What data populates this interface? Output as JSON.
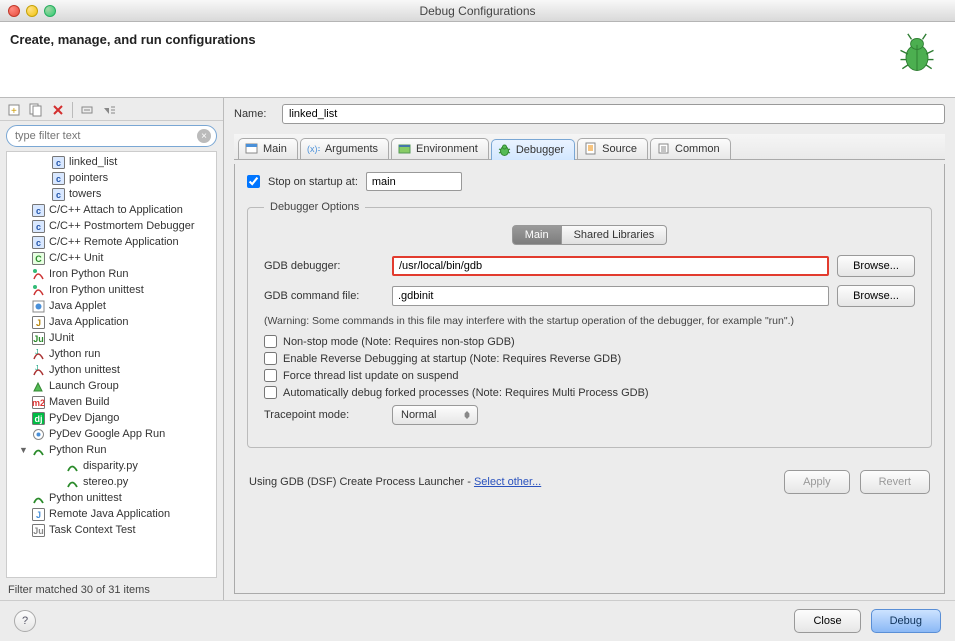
{
  "window": {
    "title": "Debug Configurations"
  },
  "header": {
    "title": "Create, manage, and run configurations"
  },
  "sidebar": {
    "filter_placeholder": "type filter text",
    "items": [
      {
        "label": "linked_list",
        "icon": "c-exe"
      },
      {
        "label": "pointers",
        "icon": "c-exe"
      },
      {
        "label": "towers",
        "icon": "c-exe"
      },
      {
        "label": "C/C++ Attach to Application",
        "icon": "c-cfg"
      },
      {
        "label": "C/C++ Postmortem Debugger",
        "icon": "c-cfg"
      },
      {
        "label": "C/C++ Remote Application",
        "icon": "c-cfg"
      },
      {
        "label": "C/C++ Unit",
        "icon": "cu"
      },
      {
        "label": "Iron Python Run",
        "icon": "ipy"
      },
      {
        "label": "Iron Python unittest",
        "icon": "ipy"
      },
      {
        "label": "Java Applet",
        "icon": "japplet"
      },
      {
        "label": "Java Application",
        "icon": "japp"
      },
      {
        "label": "JUnit",
        "icon": "junit"
      },
      {
        "label": "Jython run",
        "icon": "jy"
      },
      {
        "label": "Jython unittest",
        "icon": "jy"
      },
      {
        "label": "Launch Group",
        "icon": "launch"
      },
      {
        "label": "Maven Build",
        "icon": "m2"
      },
      {
        "label": "PyDev Django",
        "icon": "dj"
      },
      {
        "label": "PyDev Google App Run",
        "icon": "gae"
      },
      {
        "label": "Python Run",
        "icon": "py",
        "expanded": true
      },
      {
        "label": "disparity.py",
        "icon": "py",
        "child": true
      },
      {
        "label": "stereo.py",
        "icon": "py",
        "child": true
      },
      {
        "label": "Python unittest",
        "icon": "py"
      },
      {
        "label": "Remote Java Application",
        "icon": "rjava"
      },
      {
        "label": "Task Context Test",
        "icon": "task"
      }
    ],
    "status": "Filter matched 30 of 31 items"
  },
  "main": {
    "name_label": "Name:",
    "name_value": "linked_list",
    "tabs": [
      {
        "label": "Main"
      },
      {
        "label": "Arguments"
      },
      {
        "label": "Environment"
      },
      {
        "label": "Debugger",
        "active": true
      },
      {
        "label": "Source"
      },
      {
        "label": "Common"
      }
    ],
    "stop_label": "Stop on startup at:",
    "stop_value": "main",
    "options_legend": "Debugger Options",
    "subtabs": {
      "main": "Main",
      "shared": "Shared Libraries"
    },
    "gdb_debugger_label": "GDB debugger:",
    "gdb_debugger_value": "/usr/local/bin/gdb",
    "gdb_cmd_label": "GDB command file:",
    "gdb_cmd_value": ".gdbinit",
    "browse": "Browse...",
    "warning": "(Warning: Some commands in this file may interfere with the startup operation of the debugger, for example \"run\".)",
    "opt1": "Non-stop mode (Note: Requires non-stop GDB)",
    "opt2": "Enable Reverse Debugging at startup (Note: Requires Reverse GDB)",
    "opt3": "Force thread list update on suspend",
    "opt4": "Automatically debug forked processes (Note: Requires Multi Process GDB)",
    "tracepoint_label": "Tracepoint mode:",
    "tracepoint_value": "Normal",
    "launcher_text": "Using GDB (DSF) Create Process Launcher - ",
    "launcher_link": "Select other...",
    "apply": "Apply",
    "revert": "Revert"
  },
  "footer": {
    "close": "Close",
    "debug": "Debug"
  }
}
